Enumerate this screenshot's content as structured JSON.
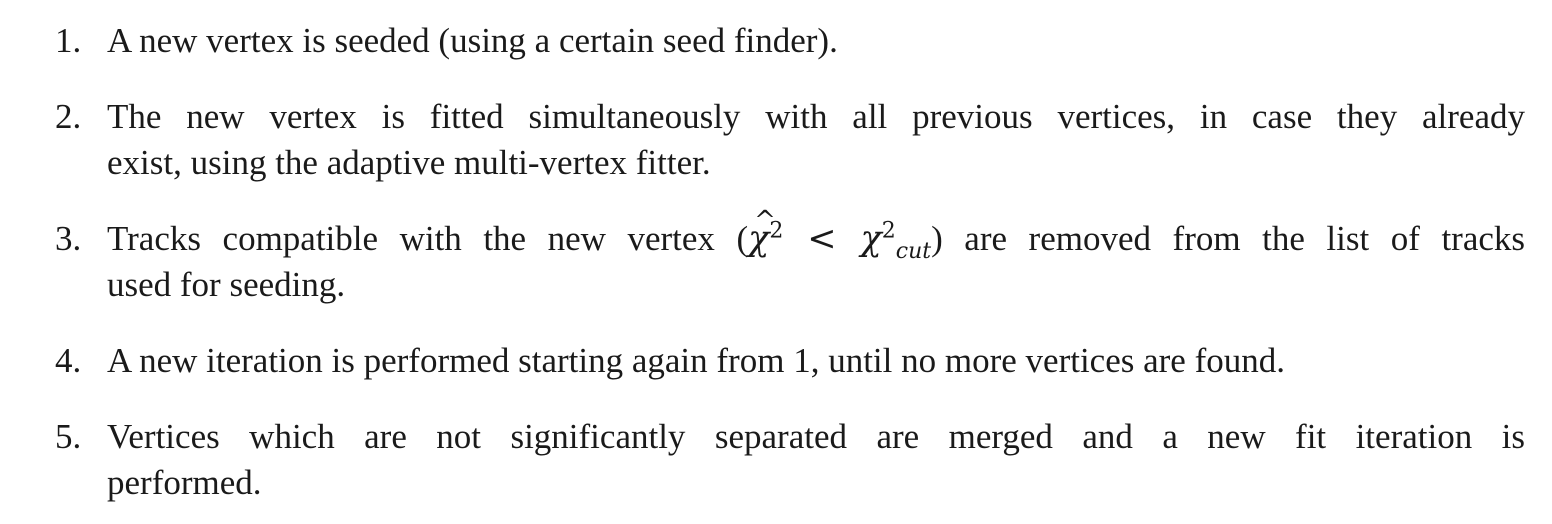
{
  "items": [
    {
      "number": "1.",
      "lines": [
        "A new vertex is seeded (using a certain seed finder)."
      ]
    },
    {
      "number": "2.",
      "lines": [
        "The new vertex is fitted simultaneously with all previous vertices, in case they already",
        "exist, using the adaptive multi-vertex fitter."
      ]
    },
    {
      "number": "3.",
      "line1_before": "Tracks compatible with the new vertex (",
      "math_chi": "χ",
      "math_sup": "2",
      "math_lt": " < ",
      "math_chi_cut": "χ",
      "math_cut_sup": "2",
      "math_cut_sub": "cut",
      "line1_after": ") are removed from the list of tracks",
      "line2": "used for seeding."
    },
    {
      "number": "4.",
      "lines": [
        "A new iteration is performed starting again from 1, until no more vertices are found."
      ]
    },
    {
      "number": "5.",
      "lines": [
        "Vertices which are not significantly separated are merged and a new fit iteration is",
        "performed."
      ]
    }
  ]
}
